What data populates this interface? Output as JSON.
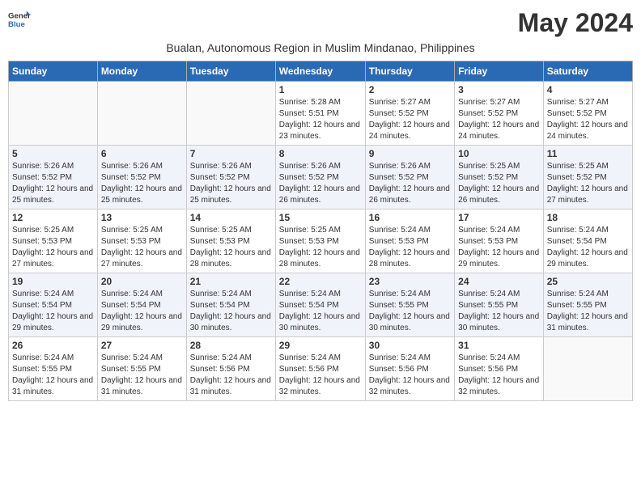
{
  "logo": {
    "general": "General",
    "blue": "Blue"
  },
  "month_title": "May 2024",
  "subtitle": "Bualan, Autonomous Region in Muslim Mindanao, Philippines",
  "days_of_week": [
    "Sunday",
    "Monday",
    "Tuesday",
    "Wednesday",
    "Thursday",
    "Friday",
    "Saturday"
  ],
  "weeks": [
    {
      "days": [
        {
          "num": "",
          "info": ""
        },
        {
          "num": "",
          "info": ""
        },
        {
          "num": "",
          "info": ""
        },
        {
          "num": "1",
          "info": "Sunrise: 5:28 AM\nSunset: 5:51 PM\nDaylight: 12 hours and 23 minutes."
        },
        {
          "num": "2",
          "info": "Sunrise: 5:27 AM\nSunset: 5:52 PM\nDaylight: 12 hours and 24 minutes."
        },
        {
          "num": "3",
          "info": "Sunrise: 5:27 AM\nSunset: 5:52 PM\nDaylight: 12 hours and 24 minutes."
        },
        {
          "num": "4",
          "info": "Sunrise: 5:27 AM\nSunset: 5:52 PM\nDaylight: 12 hours and 24 minutes."
        }
      ]
    },
    {
      "days": [
        {
          "num": "5",
          "info": "Sunrise: 5:26 AM\nSunset: 5:52 PM\nDaylight: 12 hours and 25 minutes."
        },
        {
          "num": "6",
          "info": "Sunrise: 5:26 AM\nSunset: 5:52 PM\nDaylight: 12 hours and 25 minutes."
        },
        {
          "num": "7",
          "info": "Sunrise: 5:26 AM\nSunset: 5:52 PM\nDaylight: 12 hours and 25 minutes."
        },
        {
          "num": "8",
          "info": "Sunrise: 5:26 AM\nSunset: 5:52 PM\nDaylight: 12 hours and 26 minutes."
        },
        {
          "num": "9",
          "info": "Sunrise: 5:26 AM\nSunset: 5:52 PM\nDaylight: 12 hours and 26 minutes."
        },
        {
          "num": "10",
          "info": "Sunrise: 5:25 AM\nSunset: 5:52 PM\nDaylight: 12 hours and 26 minutes."
        },
        {
          "num": "11",
          "info": "Sunrise: 5:25 AM\nSunset: 5:52 PM\nDaylight: 12 hours and 27 minutes."
        }
      ]
    },
    {
      "days": [
        {
          "num": "12",
          "info": "Sunrise: 5:25 AM\nSunset: 5:53 PM\nDaylight: 12 hours and 27 minutes."
        },
        {
          "num": "13",
          "info": "Sunrise: 5:25 AM\nSunset: 5:53 PM\nDaylight: 12 hours and 27 minutes."
        },
        {
          "num": "14",
          "info": "Sunrise: 5:25 AM\nSunset: 5:53 PM\nDaylight: 12 hours and 28 minutes."
        },
        {
          "num": "15",
          "info": "Sunrise: 5:25 AM\nSunset: 5:53 PM\nDaylight: 12 hours and 28 minutes."
        },
        {
          "num": "16",
          "info": "Sunrise: 5:24 AM\nSunset: 5:53 PM\nDaylight: 12 hours and 28 minutes."
        },
        {
          "num": "17",
          "info": "Sunrise: 5:24 AM\nSunset: 5:53 PM\nDaylight: 12 hours and 29 minutes."
        },
        {
          "num": "18",
          "info": "Sunrise: 5:24 AM\nSunset: 5:54 PM\nDaylight: 12 hours and 29 minutes."
        }
      ]
    },
    {
      "days": [
        {
          "num": "19",
          "info": "Sunrise: 5:24 AM\nSunset: 5:54 PM\nDaylight: 12 hours and 29 minutes."
        },
        {
          "num": "20",
          "info": "Sunrise: 5:24 AM\nSunset: 5:54 PM\nDaylight: 12 hours and 29 minutes."
        },
        {
          "num": "21",
          "info": "Sunrise: 5:24 AM\nSunset: 5:54 PM\nDaylight: 12 hours and 30 minutes."
        },
        {
          "num": "22",
          "info": "Sunrise: 5:24 AM\nSunset: 5:54 PM\nDaylight: 12 hours and 30 minutes."
        },
        {
          "num": "23",
          "info": "Sunrise: 5:24 AM\nSunset: 5:55 PM\nDaylight: 12 hours and 30 minutes."
        },
        {
          "num": "24",
          "info": "Sunrise: 5:24 AM\nSunset: 5:55 PM\nDaylight: 12 hours and 30 minutes."
        },
        {
          "num": "25",
          "info": "Sunrise: 5:24 AM\nSunset: 5:55 PM\nDaylight: 12 hours and 31 minutes."
        }
      ]
    },
    {
      "days": [
        {
          "num": "26",
          "info": "Sunrise: 5:24 AM\nSunset: 5:55 PM\nDaylight: 12 hours and 31 minutes."
        },
        {
          "num": "27",
          "info": "Sunrise: 5:24 AM\nSunset: 5:55 PM\nDaylight: 12 hours and 31 minutes."
        },
        {
          "num": "28",
          "info": "Sunrise: 5:24 AM\nSunset: 5:56 PM\nDaylight: 12 hours and 31 minutes."
        },
        {
          "num": "29",
          "info": "Sunrise: 5:24 AM\nSunset: 5:56 PM\nDaylight: 12 hours and 32 minutes."
        },
        {
          "num": "30",
          "info": "Sunrise: 5:24 AM\nSunset: 5:56 PM\nDaylight: 12 hours and 32 minutes."
        },
        {
          "num": "31",
          "info": "Sunrise: 5:24 AM\nSunset: 5:56 PM\nDaylight: 12 hours and 32 minutes."
        },
        {
          "num": "",
          "info": ""
        }
      ]
    }
  ]
}
